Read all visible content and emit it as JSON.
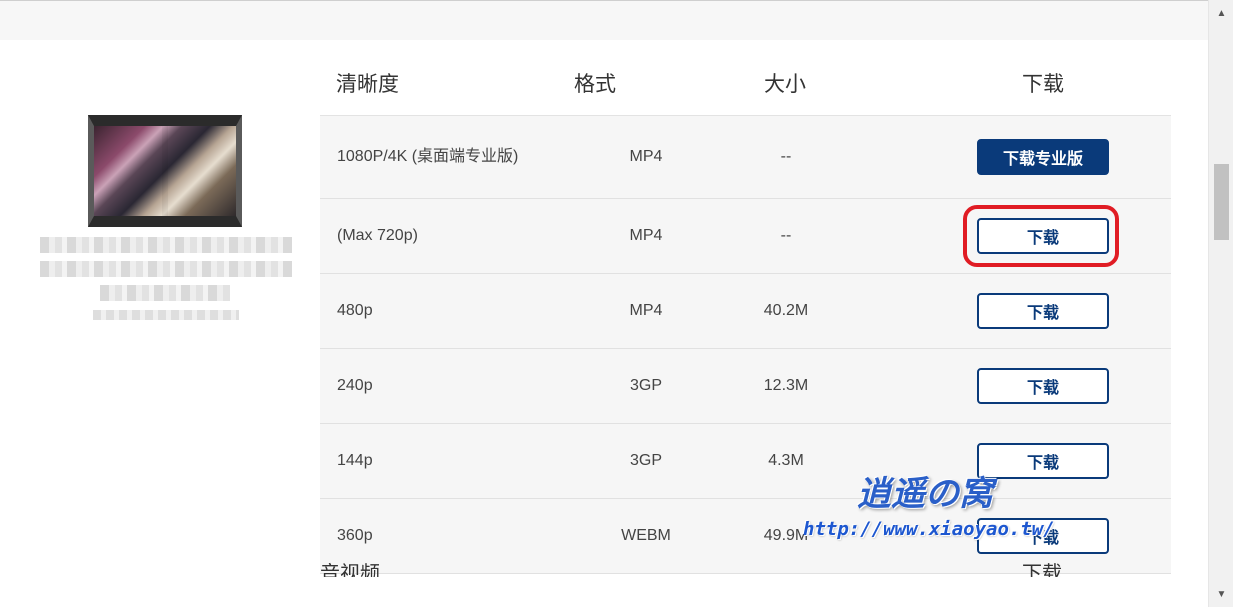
{
  "table": {
    "headers": {
      "quality": "清晰度",
      "format": "格式",
      "size": "大小",
      "download": "下载"
    },
    "rows": [
      {
        "quality": "1080P/4K (桌面端专业版)",
        "format": "MP4",
        "size": "--",
        "button": "下载专业版",
        "button_style": "filled"
      },
      {
        "quality": "(Max 720p)",
        "format": "MP4",
        "size": "--",
        "button": "下载",
        "highlighted": true
      },
      {
        "quality": "480p",
        "format": "MP4",
        "size": "40.2M",
        "button": "下载"
      },
      {
        "quality": "240p",
        "format": "3GP",
        "size": "12.3M",
        "button": "下载"
      },
      {
        "quality": "144p",
        "format": "3GP",
        "size": "4.3M",
        "button": "下载"
      },
      {
        "quality": "360p",
        "format": "WEBM",
        "size": "49.9M",
        "button": "下载"
      }
    ]
  },
  "next_section": {
    "heading": "音视频",
    "right_label": "下载"
  },
  "watermark": {
    "title": "逍遥の窝",
    "url": "http://www.xiaoyao.tw/"
  },
  "scrollbar": {
    "up_icon": "triangle-up-icon",
    "down_icon": "triangle-down-icon"
  },
  "colors": {
    "accent": "#0a3a7a",
    "highlight": "#e01c24",
    "watermark": "#2a5fc8"
  }
}
